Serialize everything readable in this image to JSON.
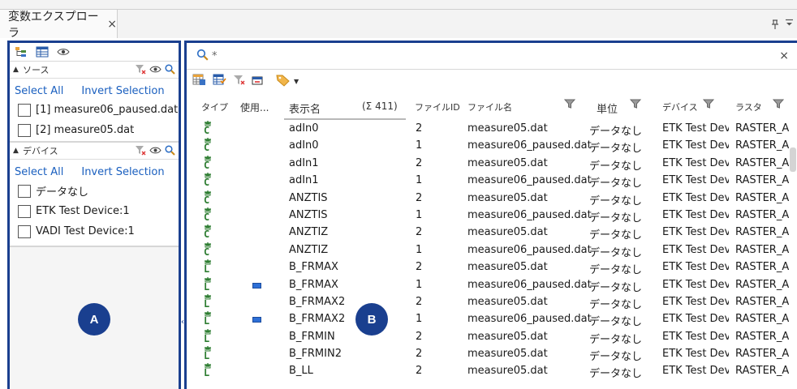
{
  "window": {
    "tab_title": "変数エクスプローラ",
    "tab_close": "×",
    "pin": "ᵖ",
    "menu": "▾"
  },
  "left_panel": {
    "callout": "A",
    "sources": {
      "title": "ソース",
      "select_all": "Select All",
      "invert_selection": "Invert Selection",
      "items": [
        {
          "label": "[1] measure06_paused.dat",
          "checked": false
        },
        {
          "label": "[2] measure05.dat",
          "checked": false
        }
      ]
    },
    "devices": {
      "title": "デバイス",
      "select_all": "Select All",
      "invert_selection": "Invert Selection",
      "items": [
        {
          "label": "データなし",
          "checked": false
        },
        {
          "label": "ETK Test Device:1",
          "checked": false
        },
        {
          "label": "VADI Test Device:1",
          "checked": false
        }
      ]
    }
  },
  "right_panel": {
    "callout": "B",
    "search": {
      "value": "*",
      "clear": "×"
    },
    "columns": {
      "type": "タイプ",
      "used": "使用...",
      "display_name": "表示名",
      "count": "(Σ 411)",
      "file_id": "ファイルID",
      "file_name": "ファイル名",
      "unit": "単位",
      "device": "デバイス",
      "raster": "ラスタ"
    },
    "rows": [
      {
        "type": "C",
        "used": false,
        "name": "adIn0",
        "file_id": "2",
        "file": "measure05.dat",
        "unit": "データなし",
        "device": "ETK Test Dev",
        "raster": "RASTER_A"
      },
      {
        "type": "C",
        "used": false,
        "name": "adIn0",
        "file_id": "1",
        "file": "measure06_paused.dat",
        "unit": "データなし",
        "device": "ETK Test Dev",
        "raster": "RASTER_A"
      },
      {
        "type": "C",
        "used": false,
        "name": "adIn1",
        "file_id": "2",
        "file": "measure05.dat",
        "unit": "データなし",
        "device": "ETK Test Dev",
        "raster": "RASTER_A"
      },
      {
        "type": "C",
        "used": false,
        "name": "adIn1",
        "file_id": "1",
        "file": "measure06_paused.dat",
        "unit": "データなし",
        "device": "ETK Test Dev",
        "raster": "RASTER_A"
      },
      {
        "type": "C",
        "used": false,
        "name": "ANZTIS",
        "file_id": "2",
        "file": "measure05.dat",
        "unit": "データなし",
        "device": "ETK Test Dev",
        "raster": "RASTER_A"
      },
      {
        "type": "C",
        "used": false,
        "name": "ANZTIS",
        "file_id": "1",
        "file": "measure06_paused.dat",
        "unit": "データなし",
        "device": "ETK Test Dev",
        "raster": "RASTER_A"
      },
      {
        "type": "C",
        "used": false,
        "name": "ANZTIZ",
        "file_id": "2",
        "file": "measure05.dat",
        "unit": "データなし",
        "device": "ETK Test Dev",
        "raster": "RASTER_A"
      },
      {
        "type": "C",
        "used": false,
        "name": "ANZTIZ",
        "file_id": "1",
        "file": "measure06_paused.dat",
        "unit": "データなし",
        "device": "ETK Test Dev",
        "raster": "RASTER_A"
      },
      {
        "type": "L",
        "used": false,
        "name": "B_FRMAX",
        "file_id": "2",
        "file": "measure05.dat",
        "unit": "データなし",
        "device": "ETK Test Dev",
        "raster": "RASTER_A"
      },
      {
        "type": "L",
        "used": true,
        "name": "B_FRMAX",
        "file_id": "1",
        "file": "measure06_paused.dat",
        "unit": "データなし",
        "device": "ETK Test Dev",
        "raster": "RASTER_A"
      },
      {
        "type": "L",
        "used": false,
        "name": "B_FRMAX2",
        "file_id": "2",
        "file": "measure05.dat",
        "unit": "データなし",
        "device": "ETK Test Dev",
        "raster": "RASTER_A"
      },
      {
        "type": "L",
        "used": true,
        "name": "B_FRMAX2",
        "file_id": "1",
        "file": "measure06_paused.dat",
        "unit": "データなし",
        "device": "ETK Test Dev",
        "raster": "RASTER_A"
      },
      {
        "type": "L",
        "used": false,
        "name": "B_FRMIN",
        "file_id": "2",
        "file": "measure05.dat",
        "unit": "データなし",
        "device": "ETK Test Dev",
        "raster": "RASTER_A"
      },
      {
        "type": "L",
        "used": false,
        "name": "B_FRMIN2",
        "file_id": "2",
        "file": "measure05.dat",
        "unit": "データなし",
        "device": "ETK Test Dev",
        "raster": "RASTER_A"
      },
      {
        "type": "L",
        "used": false,
        "name": "B_LL",
        "file_id": "2",
        "file": "measure05.dat",
        "unit": "データなし",
        "device": "ETK Test Dev",
        "raster": "RASTER_A"
      }
    ]
  },
  "colors": {
    "accent": "#1a3f8f",
    "link": "#1a5fbf",
    "type_icon": "#2e7d32",
    "used_mark": "#2d6fd6"
  }
}
